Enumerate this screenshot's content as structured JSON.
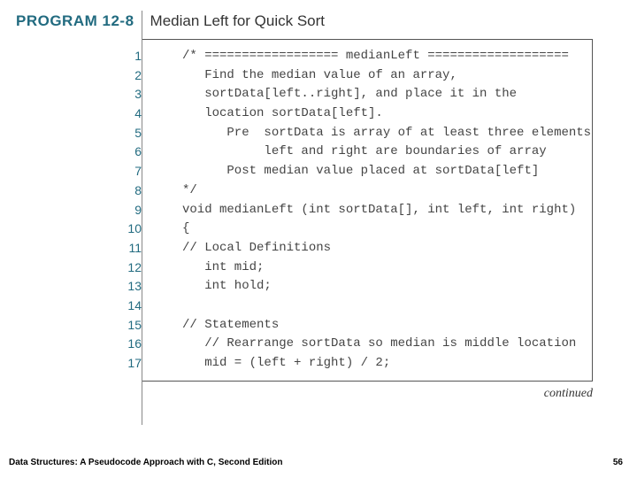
{
  "header": {
    "program_label": "PROGRAM 12-8",
    "program_title": "Median Left for Quick Sort"
  },
  "code": {
    "lines": [
      "/* ================== medianLeft ===================",
      "   Find the median value of an array,",
      "   sortData[left..right], and place it in the",
      "   location sortData[left].",
      "      Pre  sortData is array of at least three elements",
      "           left and right are boundaries of array",
      "      Post median value placed at sortData[left]",
      "*/",
      "void medianLeft (int sortData[], int left, int right)",
      "{",
      "// Local Definitions",
      "   int mid;",
      "   int hold;",
      "",
      "// Statements",
      "   // Rearrange sortData so median is middle location",
      "   mid = (left + right) / 2;"
    ]
  },
  "continued_label": "continued",
  "footer": {
    "book": "Data Structures: A Pseudocode Approach with C, Second Edition",
    "page": "56"
  }
}
